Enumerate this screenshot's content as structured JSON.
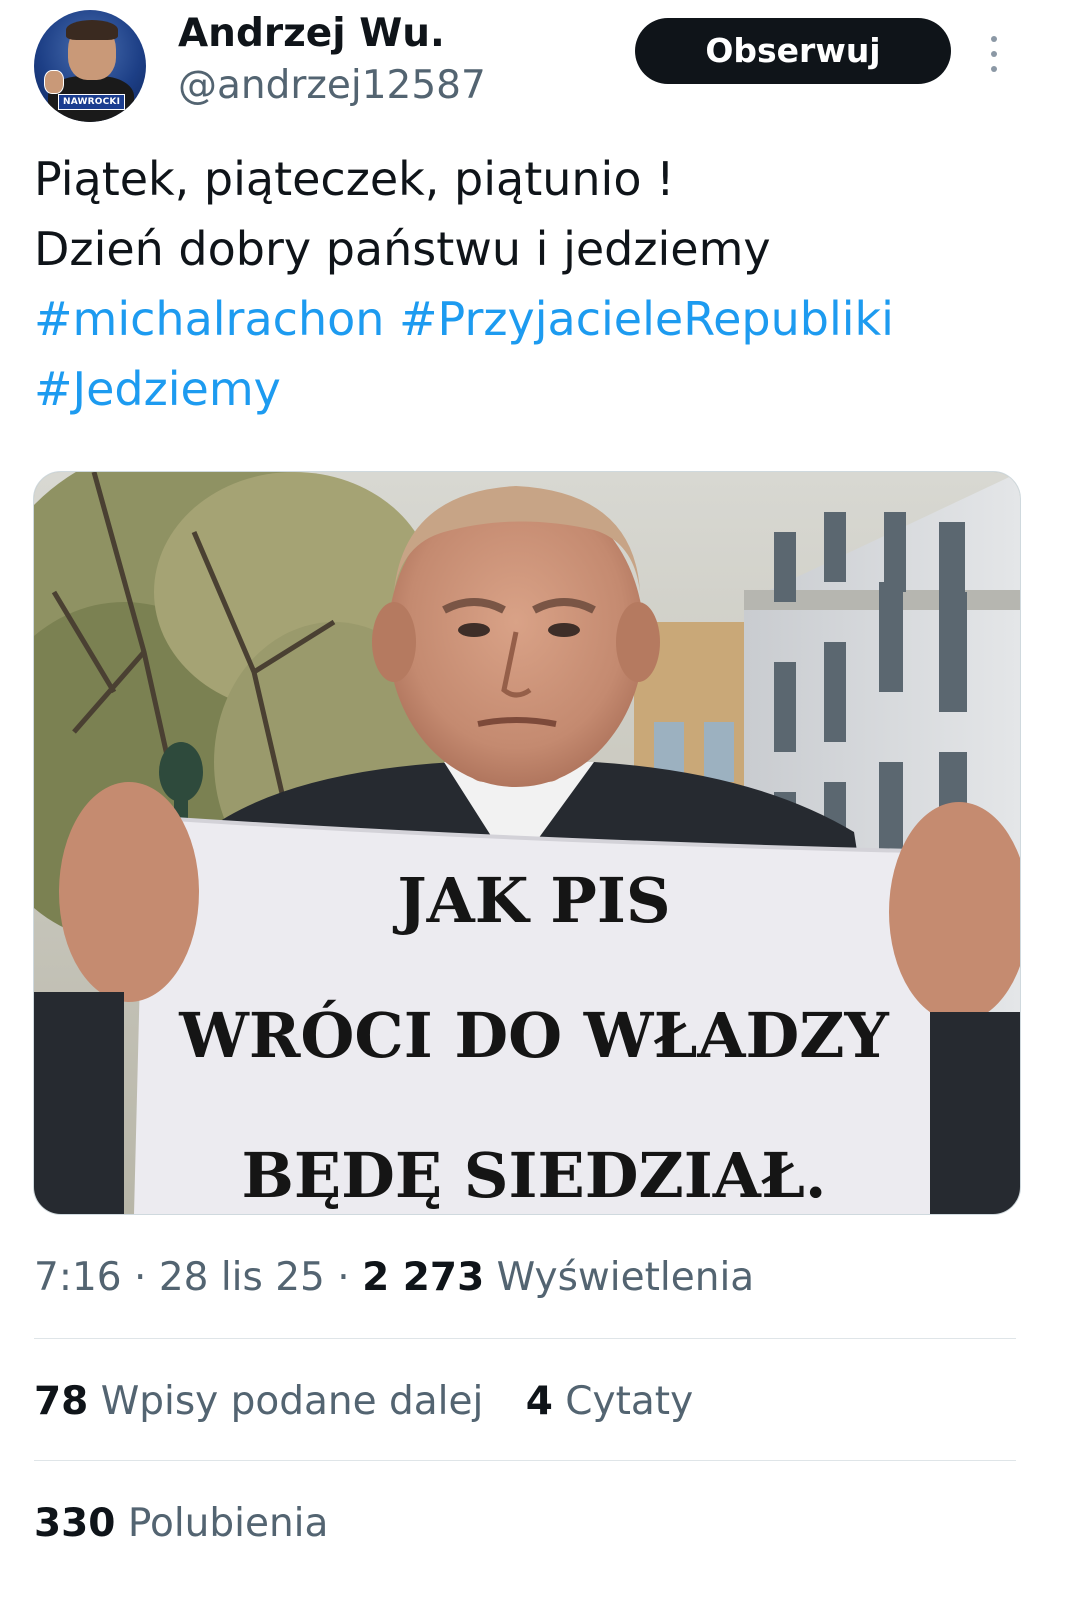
{
  "author": {
    "display_name": "Andrzej Wu.",
    "handle": "@andrzej12587",
    "avatar_badge": "NAWROCKI"
  },
  "actions": {
    "follow_label": "Obserwuj",
    "more_icon": "more-vertical-icon"
  },
  "tweet": {
    "line1": "Piątek, piąteczek, piątunio !",
    "line2": "Dzień dobry państwu i jedziemy",
    "hashtags": [
      "#michalrachon",
      "#PrzyjacieleRepubliki",
      "#Jedziemy"
    ]
  },
  "media": {
    "banner_line1": "JAK PIS",
    "banner_line2": "WRÓCI DO WŁADZY",
    "banner_line3": "BĘDĘ SIEDZIAŁ."
  },
  "meta": {
    "time": "7:16",
    "date": "28 lis 25",
    "views_count": "2 273",
    "views_label": "Wyświetlenia",
    "separator": "·"
  },
  "stats": {
    "reposts_count": "78",
    "reposts_label": "Wpisy podane dalej",
    "quotes_count": "4",
    "quotes_label": "Cytaty",
    "likes_count": "330",
    "likes_label": "Polubienia"
  },
  "colors": {
    "text": "#0f1419",
    "secondary": "#536471",
    "link": "#1d9bf0",
    "button_bg": "#0f1419",
    "divider": "#dfe5e8"
  }
}
